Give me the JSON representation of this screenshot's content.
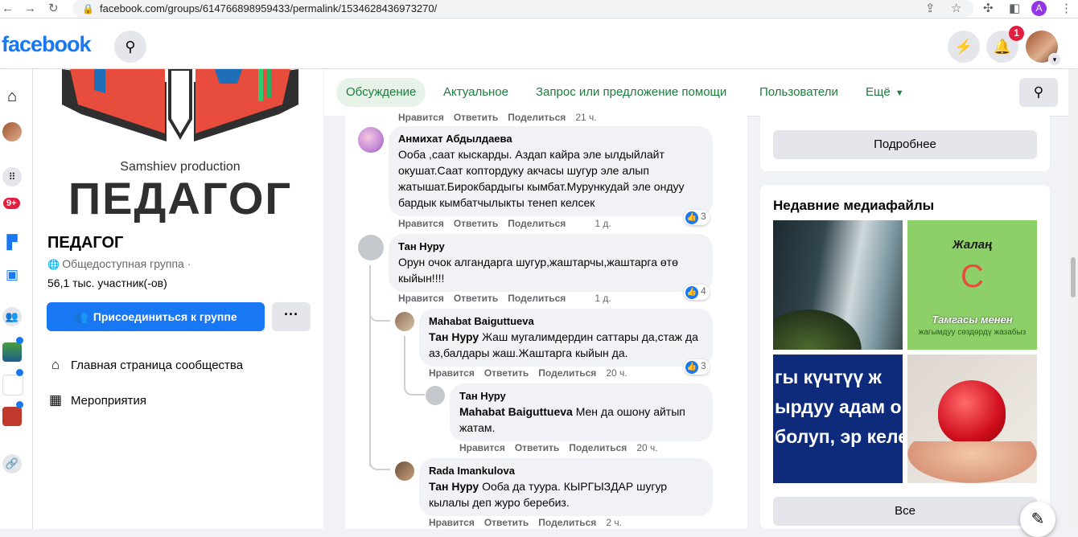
{
  "browser": {
    "url": "facebook.com/groups/614766898959433/permalink/1534628436973270/",
    "profile_letter": "A"
  },
  "header": {
    "logo": "facebook",
    "notifications_count": "1"
  },
  "left_rail": {
    "notif_badge": "9+"
  },
  "group": {
    "cover_subtitle": "Samshiev production",
    "cover_title": "ПЕДАГОГ",
    "name": "ПЕДАГОГ",
    "type": "Общедоступная группа ·",
    "members": "56,1 тыс. участник(-ов)",
    "join_label": "Присоединиться к группе",
    "more_label": "···",
    "nav": [
      {
        "label": "Главная страница сообщества"
      },
      {
        "label": "Мероприятия"
      }
    ]
  },
  "tabs": {
    "discussion": "Обсуждение",
    "trending": "Актуальное",
    "help": "Запрос или предложение помощи",
    "users": "Пользователи",
    "more": "Ещё"
  },
  "comments": {
    "top_actions": {
      "like": "Нравится",
      "reply": "Ответить",
      "share": "Поделиться",
      "time": "21 ч."
    },
    "c1": {
      "author": "Анмихат Абдылдаева",
      "text": "Ооба ,саат кыскарды. Аздап кайра эле ылдыйлайт окушат.Саат коптордуку акчасы шугур эле алып жатышат.Бирокбардыгы кымбат.Мурункудай эле ондуу бардык кымбатчылыкты тенеп келсек",
      "likes": "3",
      "like": "Нравится",
      "reply": "Ответить",
      "share": "Поделиться",
      "time": "1 д."
    },
    "c2": {
      "author": "Тан Нуру",
      "text": "Орун очок алгандарга шугур,жаштарчы,жаштарга өтө кыйын!!!!",
      "likes": "4",
      "like": "Нравится",
      "reply": "Ответить",
      "share": "Поделиться",
      "time": "1 д."
    },
    "c3": {
      "author": "Mahabat Baiguttueva",
      "mention": "Тан Нуру",
      "text": " Жаш мугалимдердин саттары да,стаж да аз,балдары жаш.Жаштарга кыйын да.",
      "likes": "3",
      "like": "Нравится",
      "reply": "Ответить",
      "share": "Поделиться",
      "time": "20 ч."
    },
    "c4": {
      "author": "Тан Нуру",
      "mention": "Mahabat Baiguttueva",
      "text": " Мен да ошону айтып жатам.",
      "like": "Нравится",
      "reply": "Ответить",
      "share": "Поделиться",
      "time": "20 ч."
    },
    "c5": {
      "author": "Rada Imankulova",
      "mention": "Тан Нуру",
      "text": " Ооба да туура. КЫРГЫЗДАР шугур кылалы деп журо беребиз.",
      "like": "Нравится",
      "reply": "Ответить",
      "share": "Поделиться",
      "time": "2 ч."
    }
  },
  "right": {
    "more_info_label": "Подробнее",
    "media_title": "Недавние медиафайлы",
    "media2_word1": "Жалаң",
    "media2_letter": "С",
    "media2_word2": "Тамгасы менен",
    "media2_word3": "жагымдуу сөздөрдү жазабыз",
    "media3_text": "ГЫ КҮЧТҮҮ Ж ЫРДУУ АДАМ О БОЛУП, ЭР КЕЛЕТ.",
    "all_label": "Все"
  }
}
